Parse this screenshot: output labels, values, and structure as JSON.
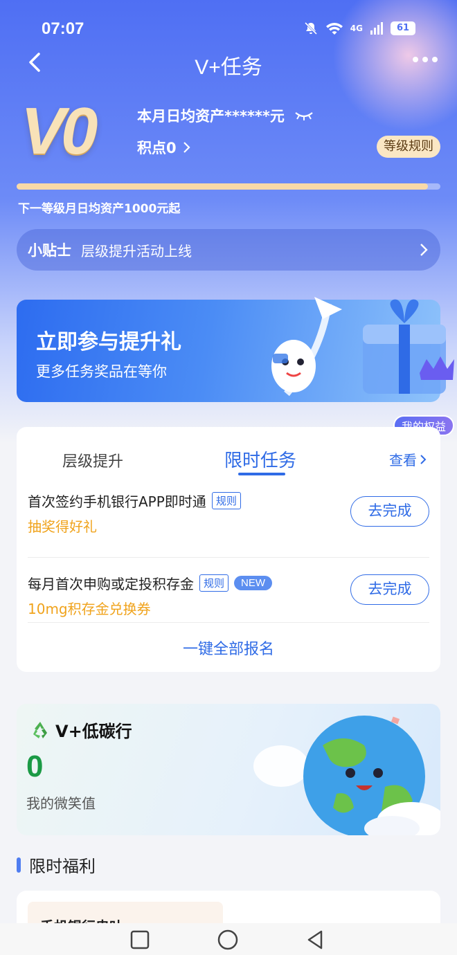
{
  "status_bar": {
    "time": "07:07",
    "network": "4G",
    "battery": "61"
  },
  "nav": {
    "title": "V+任务"
  },
  "account": {
    "level": "V0",
    "asset_text": "本月日均资产******元",
    "points_text": "积点0",
    "rules_button": "等级规则",
    "progress": 0.97,
    "next_level_text": "下一等级月日均资产1000元起"
  },
  "tips": {
    "label": "小贴士",
    "text": "层级提升活动上线"
  },
  "promo": {
    "title": "立即参与提升礼",
    "subtitle": "更多任务奖品在等你"
  },
  "benefits_badge": "我的权益",
  "tasks": {
    "tabs": [
      {
        "label": "层级提升"
      },
      {
        "label": "限时任务"
      }
    ],
    "active_tab": "限时任务",
    "view_label": "查看",
    "items": [
      {
        "name": "首次签约手机银行APP即时通",
        "tag": "规则",
        "reward": "抽奖得好礼",
        "button": "去完成"
      },
      {
        "name": "每月首次申购或定投积存金",
        "tag": "规则",
        "badge": "NEW",
        "reward": "10mg积存金兑换券",
        "button": "去完成"
      }
    ],
    "signup_all": "一键全部报名"
  },
  "carbon": {
    "title": "V+低碳行",
    "value": "0",
    "label": "我的微笑值"
  },
  "welfare": {
    "section_title": "限时福利",
    "card_title": "手机银行串叶"
  },
  "colors": {
    "primary": "#2f6be6",
    "reward": "#f0a31c",
    "carbon_green": "#1b9a45",
    "rules_bg": "#fbe7c4"
  }
}
